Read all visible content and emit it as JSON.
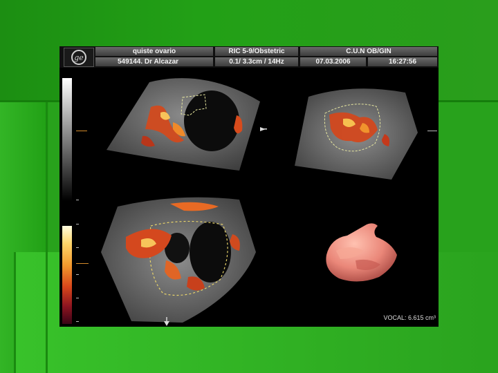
{
  "header": {
    "row1": {
      "patient_info": "quiste ovario",
      "probe": "RIC 5-9/Obstetric",
      "institution": "C.U.N OB/GIN"
    },
    "row2": {
      "study_id": "549144. Dr Alcazar",
      "params": "0.1/ 3.3cm / 14Hz",
      "date": "07.03.2006",
      "time": "16:27:56"
    }
  },
  "icons": {
    "logo": "ge-logo-icon",
    "marker": "arrow-marker-icon"
  },
  "volume": {
    "vocal_text": "VOCAL: 6.615 cm³"
  },
  "colors": {
    "slide_bg": "#22a016",
    "screen_bg": "#000000",
    "doppler_hot": "#e0562a",
    "render_surface": "#e9897c"
  }
}
